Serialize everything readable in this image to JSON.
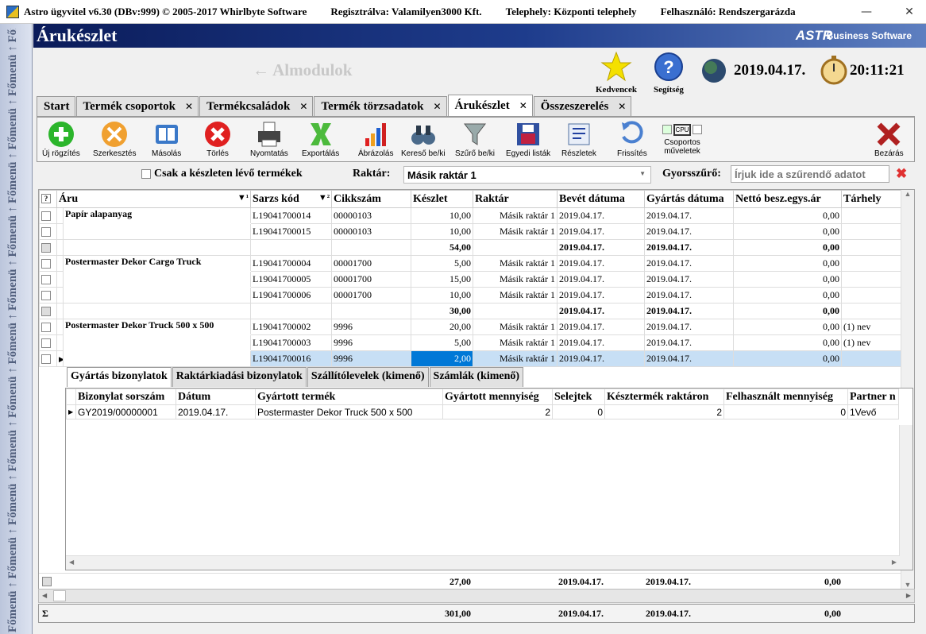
{
  "titlebar": {
    "app": "Astro ügyvitel v6.30 (DBv:999)  © 2005-2017 Whirlbyte Software",
    "reg": "Regisztrálva: Valamilyen3000 Kft.",
    "site": "Telephely: Központi telephely",
    "user": "Felhasználó: Rendszergarázda",
    "min": "—",
    "close": "✕"
  },
  "sidebar": {
    "text": "Főmenü ↑ Főmenü ↑ Főmenü ↑ Főmenü ↑ Főmenü ↑ Főmenü ↑ Főmenü ↑ Főmenü ↑ Főmenü ↑ Főmenü ↑ Főmenü ↑ Főmenü"
  },
  "header": {
    "title": "Árukészlet",
    "brand": "ASTR",
    "brand_sub": "Business Software"
  },
  "almodulok": "← Almodulok",
  "top": {
    "favorites": "Kedvencek",
    "help": "Segítség",
    "date": "2019.04.17.",
    "time": "20:11:21"
  },
  "tabs": [
    {
      "label": "Start",
      "closable": false
    },
    {
      "label": "Termék csoportok",
      "closable": true
    },
    {
      "label": "Termékcsaládok",
      "closable": true
    },
    {
      "label": "Termék törzsadatok",
      "closable": true
    },
    {
      "label": "Árukészlet",
      "closable": true,
      "active": true
    },
    {
      "label": "Összeszerelés",
      "closable": true
    }
  ],
  "tab_close": "✕",
  "toolbar": {
    "new": "Új rögzítés",
    "edit": "Szerkesztés",
    "copy": "Másolás",
    "delete": "Törlés",
    "print": "Nyomtatás",
    "export": "Exportálás",
    "chart": "Ábrázolás",
    "search": "Kereső be/ki",
    "filter": "Szűrő be/ki",
    "lists": "Egyedi listák",
    "details": "Részletek",
    "refresh": "Frissítés",
    "group": "Csoportos műveletek",
    "close": "Bezárás",
    "cpu": "CPU"
  },
  "filter": {
    "stock_only": "Csak a készleten lévő termékek",
    "warehouse_label": "Raktár:",
    "warehouse_value": "Másik raktár 1",
    "quick_label": "Gyorsszűrő:",
    "quick_placeholder": "Írjuk ide a szűrendő adatot"
  },
  "grid": {
    "headers": {
      "check": "?",
      "item": "Áru",
      "batch": "Sarzs kód",
      "sku": "Cikkszám",
      "stock": "Készlet",
      "warehouse": "Raktár",
      "in_date": "Bevét dátuma",
      "prod_date": "Gyártás dátuma",
      "net_price": "Nettó besz.egys.ár",
      "location": "Tárhely"
    },
    "sort_item": "▼¹",
    "sort_batch": "▼²",
    "groups": [
      {
        "name": "Papír alapanyag",
        "rows": [
          {
            "batch": "L19041700014",
            "sku": "00000103",
            "stock": "10,00",
            "wh": "Másik raktár 1",
            "in": "2019.04.17.",
            "prod": "2019.04.17.",
            "price": "0,00",
            "loc": ""
          },
          {
            "batch": "L19041700015",
            "sku": "00000103",
            "stock": "10,00",
            "wh": "Másik raktár 1",
            "in": "2019.04.17.",
            "prod": "2019.04.17.",
            "price": "0,00",
            "loc": ""
          }
        ],
        "total": {
          "stock": "54,00",
          "in": "2019.04.17.",
          "prod": "2019.04.17.",
          "price": "0,00"
        }
      },
      {
        "name": "Postermaster Dekor Cargo Truck",
        "rows": [
          {
            "batch": "L19041700004",
            "sku": "00001700",
            "stock": "5,00",
            "wh": "Másik raktár 1",
            "in": "2019.04.17.",
            "prod": "2019.04.17.",
            "price": "0,00",
            "loc": ""
          },
          {
            "batch": "L19041700005",
            "sku": "00001700",
            "stock": "15,00",
            "wh": "Másik raktár 1",
            "in": "2019.04.17.",
            "prod": "2019.04.17.",
            "price": "0,00",
            "loc": ""
          },
          {
            "batch": "L19041700006",
            "sku": "00001700",
            "stock": "10,00",
            "wh": "Másik raktár 1",
            "in": "2019.04.17.",
            "prod": "2019.04.17.",
            "price": "0,00",
            "loc": ""
          }
        ],
        "total": {
          "stock": "30,00",
          "in": "2019.04.17.",
          "prod": "2019.04.17.",
          "price": "0,00"
        }
      },
      {
        "name": "Postermaster Dekor Truck  500 x 500",
        "rows": [
          {
            "batch": "L19041700002",
            "sku": "9996",
            "stock": "20,00",
            "wh": "Másik raktár 1",
            "in": "2019.04.17.",
            "prod": "2019.04.17.",
            "price": "0,00",
            "loc": "(1) nev"
          },
          {
            "batch": "L19041700003",
            "sku": "9996",
            "stock": "5,00",
            "wh": "Másik raktár 1",
            "in": "2019.04.17.",
            "prod": "2019.04.17.",
            "price": "0,00",
            "loc": "(1) nev"
          },
          {
            "batch": "L19041700016",
            "sku": "9996",
            "stock": "2,00",
            "wh": "Másik raktár 1",
            "in": "2019.04.17.",
            "prod": "2019.04.17.",
            "price": "0,00",
            "loc": ""
          }
        ],
        "total": {
          "stock": "27,00",
          "in": "2019.04.17.",
          "prod": "2019.04.17.",
          "price": "0,00"
        }
      }
    ],
    "grand_total": {
      "sigma": "Σ",
      "stock": "301,00",
      "in": "2019.04.17.",
      "prod": "2019.04.17.",
      "price": "0,00"
    }
  },
  "detail": {
    "tabs": [
      "Gyártás bizonylatok",
      "Raktárkiadási bizonylatok",
      "Szállítólevelek (kimenő)",
      "Számlák (kimenő)"
    ],
    "headers": [
      "Bizonylat sorszám",
      "Dátum",
      "Gyártott termék",
      "Gyártott mennyiség",
      "Selejtek",
      "Késztermék raktáron",
      "Felhasznált mennyiség",
      "Partner n"
    ],
    "rows": [
      [
        "GY2019/00000001",
        "2019.04.17.",
        "Postermaster Dekor Truck  500 x 500",
        "2",
        "0",
        "2",
        "0",
        "1Vevő"
      ]
    ]
  }
}
